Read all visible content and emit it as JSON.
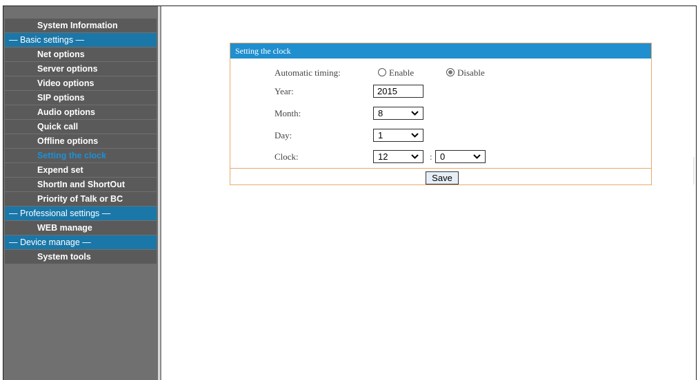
{
  "sidebar": {
    "items": [
      {
        "type": "item",
        "label": "System Information",
        "active": false
      },
      {
        "type": "header",
        "label": "— Basic settings —"
      },
      {
        "type": "item",
        "label": "Net options",
        "active": false
      },
      {
        "type": "item",
        "label": "Server options",
        "active": false
      },
      {
        "type": "item",
        "label": "Video options",
        "active": false
      },
      {
        "type": "item",
        "label": "SIP options",
        "active": false
      },
      {
        "type": "item",
        "label": "Audio options",
        "active": false
      },
      {
        "type": "item",
        "label": "Quick call",
        "active": false
      },
      {
        "type": "item",
        "label": "Offline options",
        "active": false
      },
      {
        "type": "item",
        "label": "Setting the clock",
        "active": true
      },
      {
        "type": "item",
        "label": "Expend set",
        "active": false
      },
      {
        "type": "item",
        "label": "ShortIn and ShortOut",
        "active": false
      },
      {
        "type": "item",
        "label": "Priority of Talk or BC",
        "active": false
      },
      {
        "type": "header",
        "label": "— Professional settings —"
      },
      {
        "type": "item",
        "label": "WEB manage",
        "active": false
      },
      {
        "type": "header",
        "label": "— Device manage —"
      },
      {
        "type": "item",
        "label": "System tools",
        "active": false
      }
    ]
  },
  "panel": {
    "title": "Setting the clock",
    "automatic_timing": {
      "label": "Automatic timing:",
      "options": [
        "Enable",
        "Disable"
      ],
      "selected": "Disable"
    },
    "year": {
      "label": "Year:",
      "value": "2015"
    },
    "month": {
      "label": "Month:",
      "value": "8"
    },
    "day": {
      "label": "Day:",
      "value": "1"
    },
    "clock": {
      "label": "Clock:",
      "hour": "12",
      "separator": ":",
      "minute": "0"
    },
    "save_label": "Save"
  },
  "colors": {
    "sidebar_bg": "#707070",
    "nav_item_bg": "#5a5a5a",
    "nav_header_bg": "#1a77a8",
    "active_text": "#1f8fd6",
    "panel_title_bg": "#1f8fcf",
    "panel_border": "#e8a96a"
  }
}
